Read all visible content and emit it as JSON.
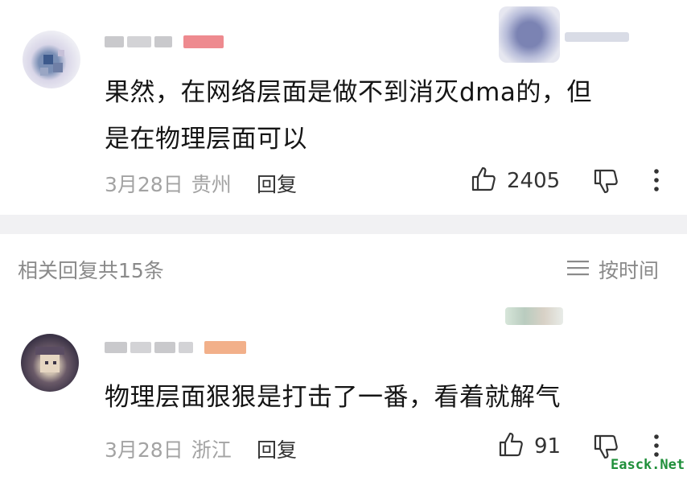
{
  "comment": {
    "content_line1": "果然，在网络层面是做不到消灭dma的，但",
    "content_line2": "是在物理层面可以",
    "date": "3月28日",
    "location": "贵州",
    "reply_label": "回复",
    "like_count": "2405"
  },
  "replies_header": {
    "title": "相关回复共15条",
    "sort_label": "按时间"
  },
  "reply": {
    "content": "物理层面狠狠是打击了一番，看着就解气",
    "date": "3月28日",
    "location": "浙江",
    "reply_label": "回复",
    "like_count": "91"
  },
  "watermark": "Easck.Net",
  "icons": {
    "like": "thumbs-up-icon",
    "dislike": "thumbs-down-icon",
    "more": "more-vertical-icon",
    "sort": "sort-lines-icon"
  }
}
